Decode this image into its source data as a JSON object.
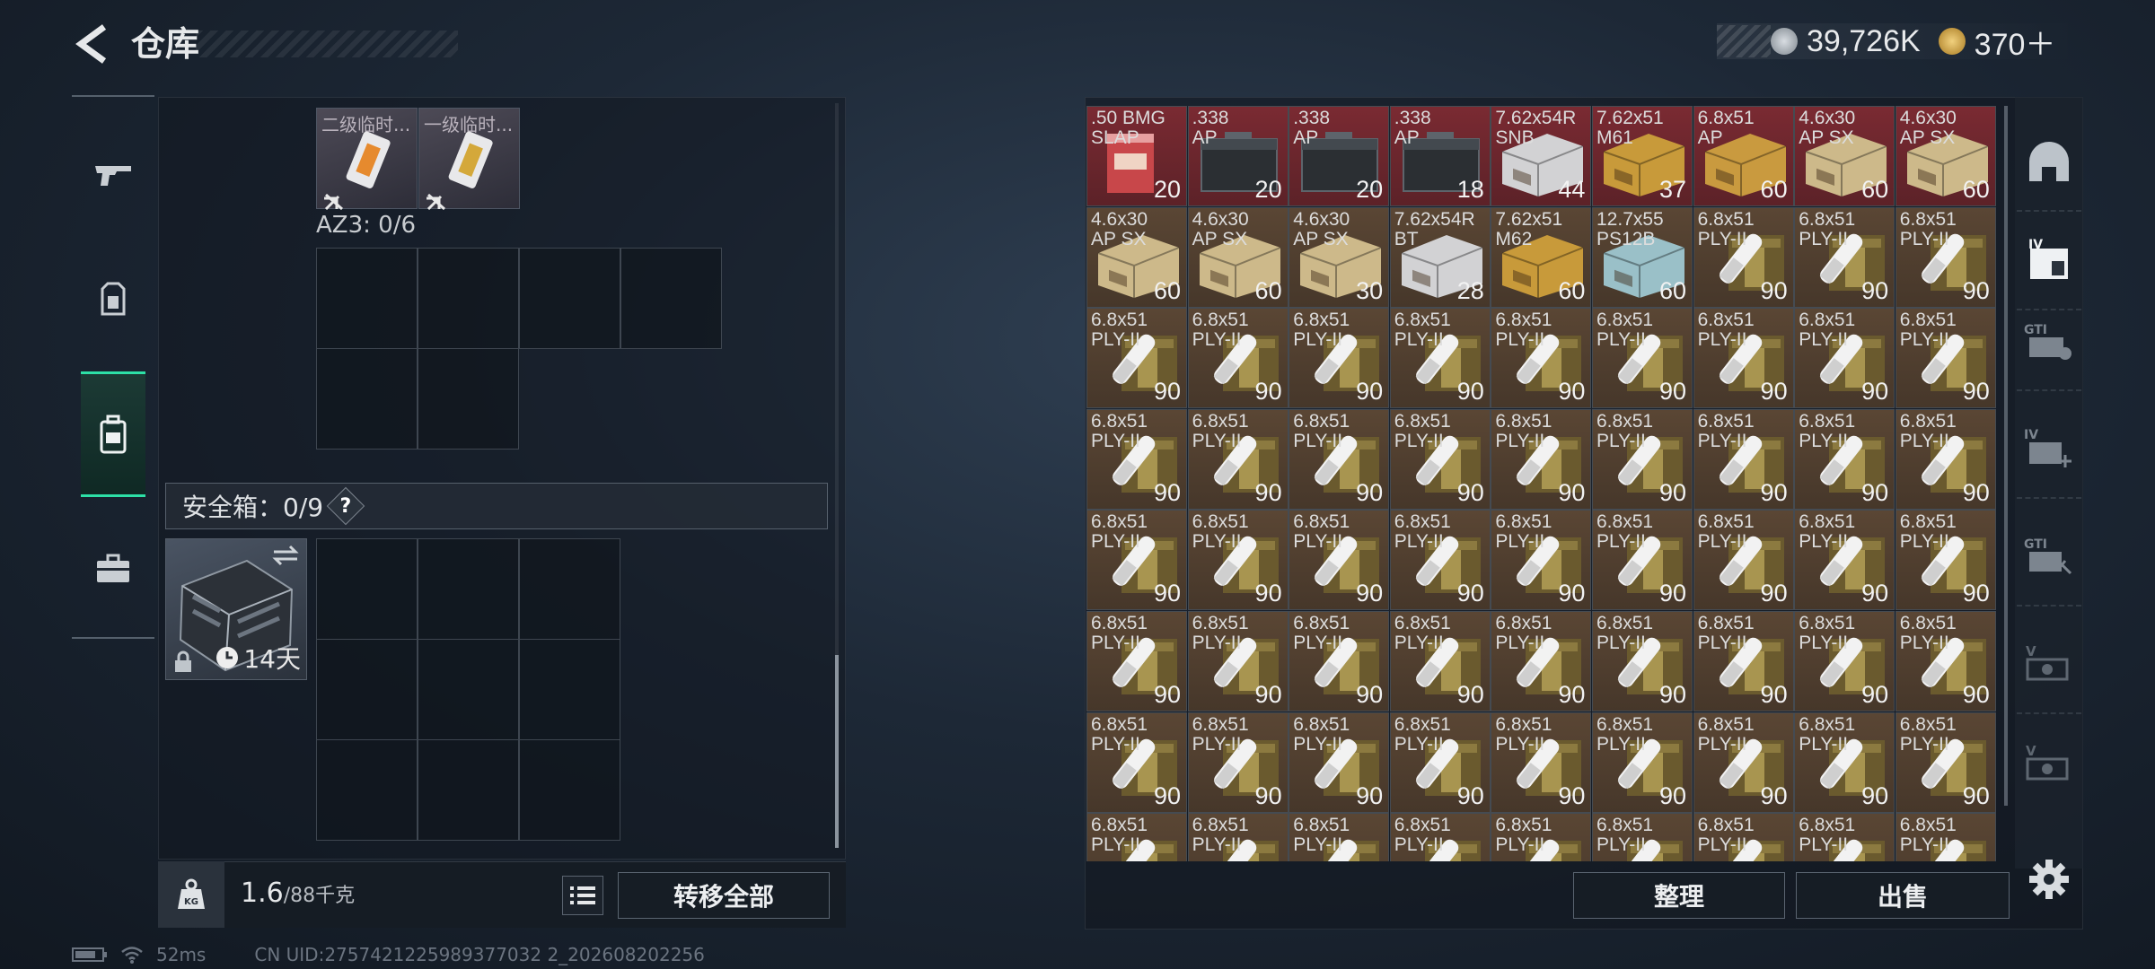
{
  "header": {
    "title": "仓库"
  },
  "currency": {
    "coins": "39,726K",
    "premium": "370＋"
  },
  "left_tabs": [
    {
      "name": "weapon-tab",
      "icon": "gun-icon"
    },
    {
      "name": "armor-tab",
      "icon": "armor-icon"
    },
    {
      "name": "backpack-tab",
      "icon": "backpack-icon",
      "active": true
    },
    {
      "name": "case-tab",
      "icon": "briefcase-icon"
    }
  ],
  "pocket_items": [
    {
      "name": "二级临时...",
      "tint": "#e68a2e"
    },
    {
      "name": "一级临时...",
      "tint": "#d4a83a"
    }
  ],
  "az3": {
    "label": "AZ3: 0/6"
  },
  "safebox": {
    "label": "安全箱：0/9",
    "help": "?",
    "days": "14天"
  },
  "bottom_left": {
    "weight": "1.6",
    "weight_max": "/88千克",
    "transfer_label": "转移全部"
  },
  "status": {
    "ping": "52ms",
    "uid": "CN UID:2757421225989377032 2_202608202256"
  },
  "stash": [
    [
      {
        "l": ".50 BMG\nSLAP",
        "c": "20",
        "t": "red"
      },
      {
        "l": ".338\nAP",
        "c": "20",
        "t": "red"
      },
      {
        "l": ".338\nAP",
        "c": "20",
        "t": "red"
      },
      {
        "l": ".338\nAP",
        "c": "18",
        "t": "red"
      },
      {
        "l": "7.62x54R\nSNB",
        "c": "44",
        "t": "red"
      },
      {
        "l": "7.62x51\nM61",
        "c": "37",
        "t": "red"
      },
      {
        "l": "6.8x51\nAP",
        "c": "60",
        "t": "red"
      },
      {
        "l": "4.6x30\nAP SX",
        "c": "60",
        "t": "red"
      },
      {
        "l": "4.6x30\nAP SX",
        "c": "60",
        "t": "red"
      }
    ],
    [
      {
        "l": "4.6x30\nAP SX",
        "c": "60",
        "t": "brown"
      },
      {
        "l": "4.6x30\nAP SX",
        "c": "60",
        "t": "brown"
      },
      {
        "l": "4.6x30\nAP SX",
        "c": "30",
        "t": "brown"
      },
      {
        "l": "7.62x54R\nBT",
        "c": "28",
        "t": "brown"
      },
      {
        "l": "7.62x51\nM62",
        "c": "60",
        "t": "brown"
      },
      {
        "l": "12.7x55\nPS12B",
        "c": "60",
        "t": "brown"
      },
      {
        "l": "6.8x51\nPLY-II",
        "c": "90",
        "t": "brown"
      },
      {
        "l": "6.8x51\nPLY-II",
        "c": "90",
        "t": "brown"
      },
      {
        "l": "6.8x51\nPLY-II",
        "c": "90",
        "t": "brown"
      }
    ]
  ],
  "stash_fill": {
    "l": "6.8x51\nPLY-II",
    "c": "90"
  },
  "right_buttons": {
    "sort": "整理",
    "sell": "出售"
  },
  "side_tabs": [
    "dome-icon",
    "tier-iv-case-icon",
    "gti-case-icon",
    "tier-iv-plus-icon",
    "gti-plus-icon",
    "v-case-icon",
    "v-case-2-icon"
  ]
}
